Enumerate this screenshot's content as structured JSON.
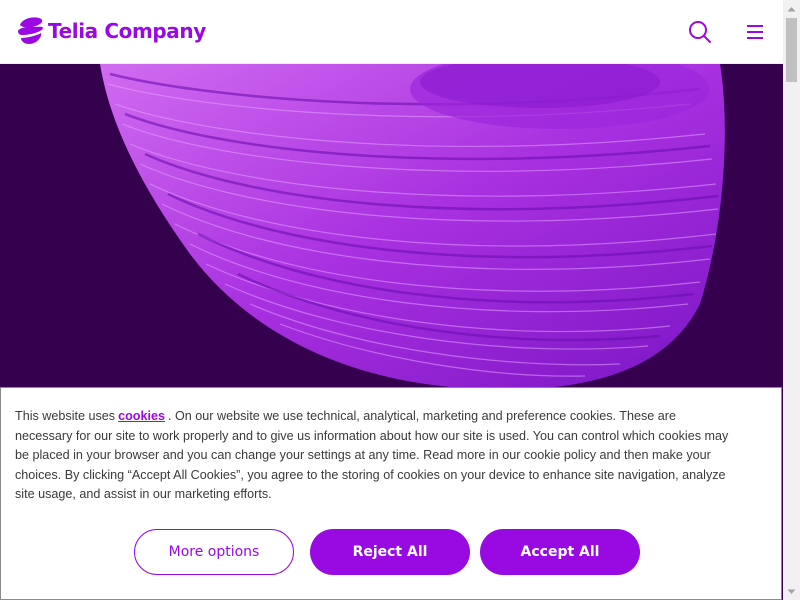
{
  "header": {
    "brand": "Telia Company",
    "search_icon": "search-icon",
    "menu_icon": "hamburger-menu-icon"
  },
  "colors": {
    "brand_purple": "#990ae3",
    "hero_bg": "#35004d",
    "text": "#3a3a3a"
  },
  "cookie_banner": {
    "text_before": "This website uses",
    "link_text": "cookies",
    "text_after": ". On our website we use technical, analytical, marketing and preference cookies. These are necessary for our site to work properly and to give us information about how our site is used. You can control which cookies may be placed in your browser and you can change your settings at any time. Read more in our cookie policy and then make your choices. By clicking “Accept All Cookies”, you agree to the storing of cookies on your device to enhance site navigation, analyze site usage, and assist in our marketing efforts.",
    "buttons": {
      "more_options": "More options",
      "reject_all": "Reject All",
      "accept_all": "Accept All"
    }
  }
}
